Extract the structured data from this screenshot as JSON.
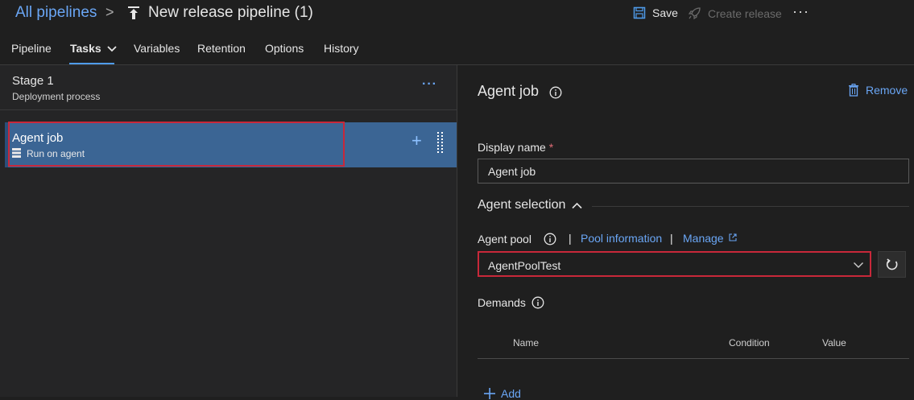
{
  "header": {
    "breadcrumb_root": "All pipelines",
    "breadcrumb_sep": ">",
    "pipeline_title": "New release pipeline (1)",
    "save_label": "Save",
    "create_release_label": "Create release",
    "more_label": "···"
  },
  "tabs": [
    {
      "label": "Pipeline"
    },
    {
      "label": "Tasks",
      "active": true
    },
    {
      "label": "Variables"
    },
    {
      "label": "Retention"
    },
    {
      "label": "Options"
    },
    {
      "label": "History"
    }
  ],
  "stage": {
    "title": "Stage 1",
    "subtitle": "Deployment process",
    "more_label": "···"
  },
  "job": {
    "title": "Agent job",
    "subtitle": "Run on agent"
  },
  "details": {
    "title": "Agent job",
    "remove_label": "Remove",
    "display_name_label": "Display name",
    "required_mark": "*",
    "display_name_value": "Agent job",
    "agent_selection_label": "Agent selection",
    "agent_pool_label": "Agent pool",
    "pool_information_link": "Pool information",
    "manage_link": "Manage",
    "link_sep": "|",
    "agent_pool_value": "AgentPoolTest",
    "demands_label": "Demands",
    "demands_columns": [
      "Name",
      "Condition",
      "Value"
    ],
    "add_label": "Add"
  },
  "colors": {
    "accent": "#6aa6f5",
    "selected_row": "#3b6594",
    "highlight_outline": "#c8283a",
    "background": "#1f1f1f"
  }
}
